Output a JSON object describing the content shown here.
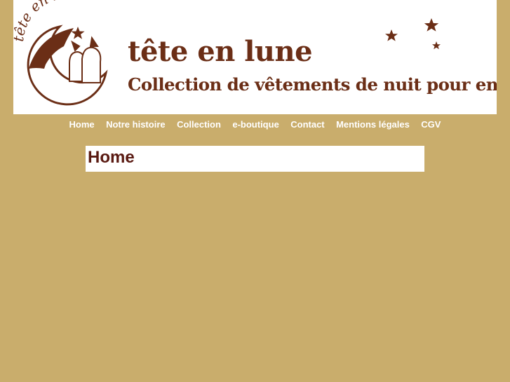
{
  "banner": {
    "logo_text": "tête en lune",
    "title": "tête en lune",
    "tagline": "Collection de vêtements de nuit pour enfants"
  },
  "nav": {
    "items": [
      {
        "label": "Home"
      },
      {
        "label": "Notre histoire"
      },
      {
        "label": "Collection"
      },
      {
        "label": "e-boutique"
      },
      {
        "label": "Contact"
      },
      {
        "label": "Mentions légales"
      },
      {
        "label": "CGV"
      }
    ]
  },
  "main": {
    "title": "Home"
  },
  "colors": {
    "background": "#c9ad6c",
    "brand_brown": "#6b2e16",
    "title_red": "#5a1a12",
    "nav_text": "#ffffff"
  }
}
